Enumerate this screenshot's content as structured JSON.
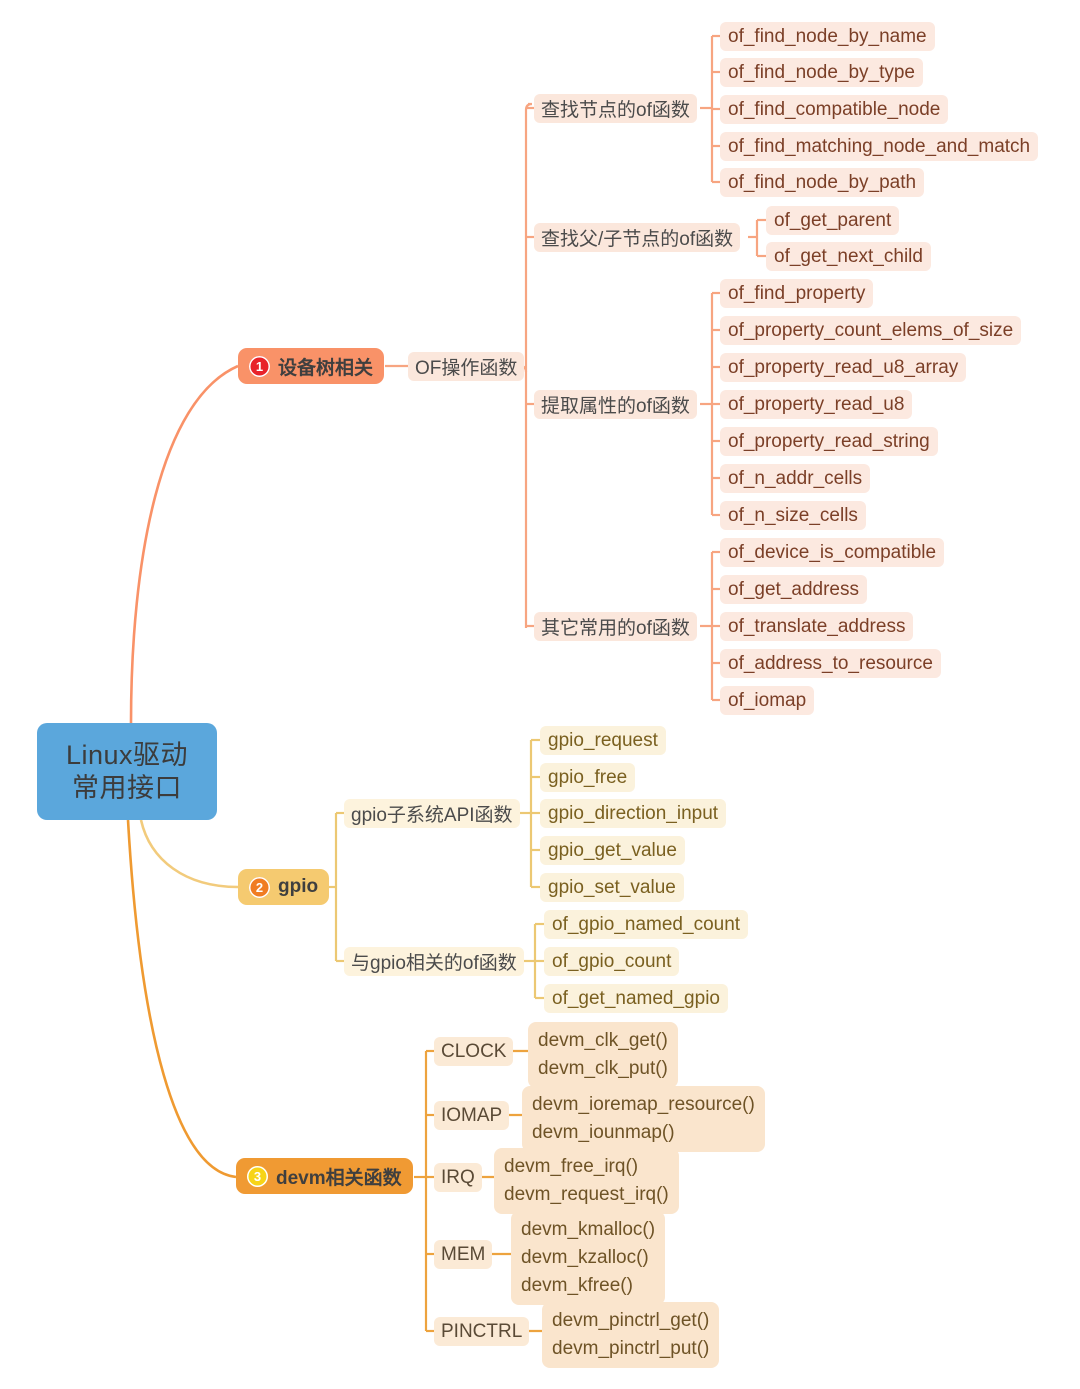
{
  "root": {
    "line1": "Linux驱动",
    "line2": "常用接口",
    "color": "#5ba7dc"
  },
  "branches": [
    {
      "id": "device-tree",
      "badge": "❶",
      "badge_number": "1",
      "label": "设备树相关",
      "color": "#f99268",
      "badge_color": "#e8232a",
      "category": "OF操作函数",
      "groups": [
        {
          "label": "查找节点的of函数",
          "items": [
            "of_find_node_by_name",
            "of_find_node_by_type",
            "of_find_compatible_node",
            "of_find_matching_node_and_match",
            "of_find_node_by_path"
          ]
        },
        {
          "label": "查找父/子节点的of函数",
          "items": [
            "of_get_parent",
            "of_get_next_child"
          ]
        },
        {
          "label": "提取属性的of函数",
          "items": [
            "of_find_property",
            "of_property_count_elems_of_size",
            "of_property_read_u8_array",
            "of_property_read_u8",
            "of_property_read_string",
            "of_n_addr_cells",
            "of_n_size_cells"
          ]
        },
        {
          "label": "其它常用的of函数",
          "items": [
            "of_device_is_compatible",
            "of_get_address",
            "of_translate_address",
            "of_address_to_resource",
            "of_iomap"
          ]
        }
      ]
    },
    {
      "id": "gpio",
      "badge": "❷",
      "badge_number": "2",
      "label": "gpio",
      "color": "#f5ca70",
      "badge_color": "#f07c23",
      "groups": [
        {
          "label": "gpio子系统API函数",
          "items": [
            "gpio_request",
            "gpio_free",
            "gpio_direction_input",
            "gpio_get_value",
            "gpio_set_value"
          ]
        },
        {
          "label": "与gpio相关的of函数",
          "items": [
            "of_gpio_named_count",
            "of_gpio_count",
            "of_get_named_gpio"
          ]
        }
      ]
    },
    {
      "id": "devm",
      "badge": "❸",
      "badge_number": "3",
      "label": "devm相关函数",
      "color": "#f09a33",
      "badge_color": "#f7d417",
      "groups": [
        {
          "label": "CLOCK",
          "items": [
            "devm_clk_get()",
            "devm_clk_put()"
          ]
        },
        {
          "label": "IOMAP",
          "items": [
            "devm_ioremap_resource()",
            "devm_iounmap()"
          ]
        },
        {
          "label": "IRQ",
          "items": [
            "devm_free_irq()",
            "devm_request_irq()"
          ]
        },
        {
          "label": "MEM",
          "items": [
            "devm_kmalloc()",
            "devm_kzalloc()",
            "devm_kfree()"
          ]
        },
        {
          "label": "PINCTRL",
          "items": [
            "devm_pinctrl_get()",
            "devm_pinctrl_put()"
          ]
        }
      ]
    }
  ]
}
